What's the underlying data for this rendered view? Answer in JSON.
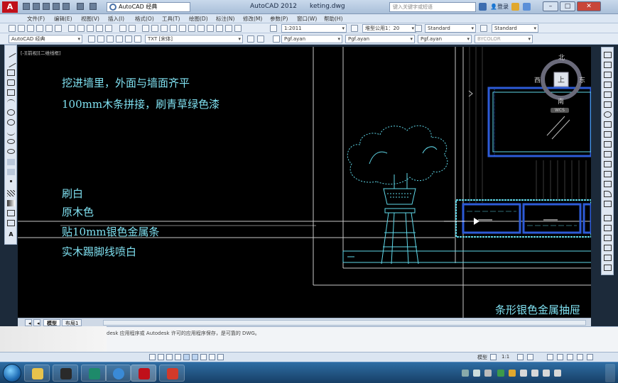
{
  "app": {
    "logo_letter": "A",
    "workspace": "AutoCAD 经典",
    "title": "AutoCAD 2012",
    "filename": "keting.dwg",
    "search_placeholder": "键入关键字或短语",
    "login": "登录",
    "brand_color": "#c0101a"
  },
  "menu": [
    "文件(F)",
    "编辑(E)",
    "视图(V)",
    "插入(I)",
    "格式(O)",
    "工具(T)",
    "绘图(D)",
    "标注(N)",
    "修改(M)",
    "参数(P)",
    "窗口(W)",
    "帮助(H)"
  ],
  "toolbar": {
    "workspace_combo": "AutoCAD 经典",
    "text_style": "TXT",
    "text_style_note": "[宋体]",
    "scale": "1:2011",
    "dim_style": "堆型公用1：20",
    "table_style": "Standard",
    "multileader_style": "Standard",
    "layer": "0",
    "linetype1": "Pgf.ayan",
    "linetype2": "Pgf.ayan",
    "lineweight": "Pgf.ayan",
    "plotstyle": "BYCOLOR"
  },
  "viewport": {
    "label": "[-][前视][二维线框]"
  },
  "viewcube": {
    "north": "北",
    "south": "南",
    "east": "东",
    "west": "西",
    "face": "上",
    "wcs": "WCS"
  },
  "annotations": {
    "note1": "挖进墙里，外面与墙面齐平",
    "note2": "100mm木条拼接，刷青草绿色漆",
    "note3": "刷白",
    "note4": "原木色",
    "note5": "贴10mm银色金属条",
    "note6": "实木踢脚线喷白",
    "note7": "条形银色金属抽屉"
  },
  "layout_tabs": [
    "模型",
    "布局1"
  ],
  "command_line": "desk 应用程序或 Autodesk 许可的应用程序保存，是可靠的 DWG。",
  "status": {
    "model": "模型",
    "annotation_scale": "1:1"
  },
  "colors": {
    "canvas": "#000000",
    "annotation_text": "#7fe0f0",
    "drawing_line": "#5fd7e8",
    "selection_blue": "#2d5bd8"
  }
}
